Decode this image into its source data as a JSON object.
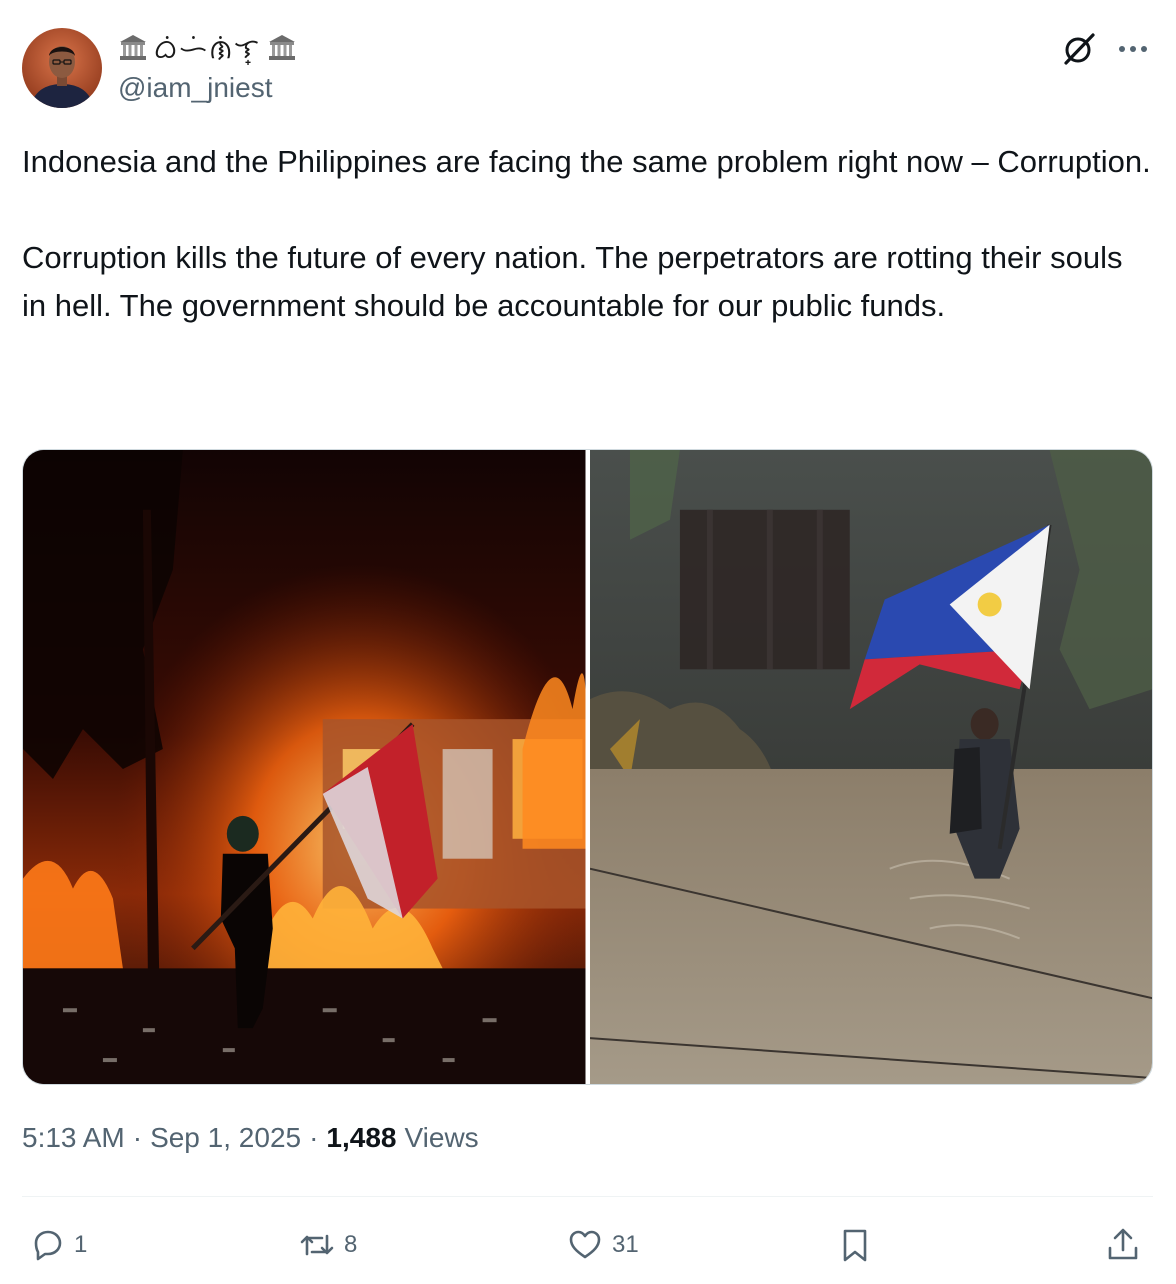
{
  "author": {
    "display_name_glyph": "ᜊᜒᜑᜒᜈᜒᜎ᜔",
    "handle": "@iam_jniest",
    "avatar_icon": "profile-photo",
    "pillar_icon": "classical-building-icon"
  },
  "header_actions": {
    "grok_icon": "grok-icon",
    "more_icon": "more-icon"
  },
  "tweet": {
    "paragraph_1": "Indonesia and the Philippines are facing the same problem right now – Corruption.",
    "paragraph_2": "Corruption kills the future of every nation. The perpetrators are rotting their souls in hell. The government should be accountable for our public funds."
  },
  "media": [
    {
      "icon": "photo-fire-protest-flag"
    },
    {
      "icon": "photo-flood-philippine-flag"
    }
  ],
  "meta": {
    "time": "5:13 AM",
    "sep_1": "·",
    "date": "Sep 1, 2025",
    "sep_2": "·",
    "views_count": "1,488",
    "views_label": "Views"
  },
  "actions": {
    "reply_count": "1",
    "repost_count": "8",
    "like_count": "31"
  },
  "colors": {
    "text_primary": "#0f1419",
    "text_secondary": "#536471",
    "border": "#cfd9de"
  }
}
